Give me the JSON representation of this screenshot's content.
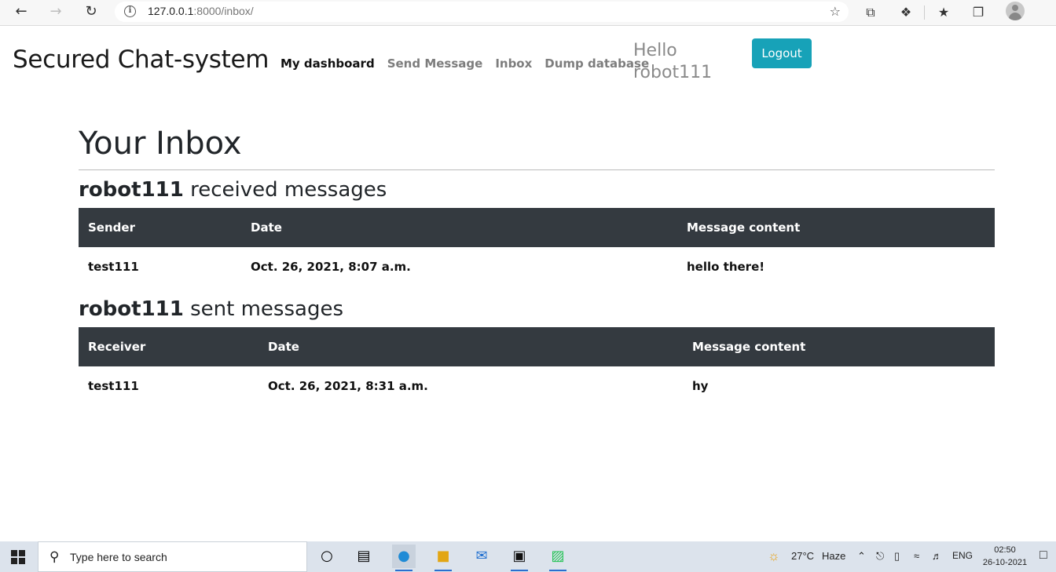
{
  "browser": {
    "url_host": "127.0.0.1",
    "url_rest": ":8000/inbox/"
  },
  "nav": {
    "brand": "Secured Chat-system",
    "links": [
      "My dashboard",
      "Send Message",
      "Inbox",
      "Dump database"
    ],
    "hello_line1": "Hello",
    "hello_line2": "robot111",
    "logout": "Logout"
  },
  "page": {
    "title": "Your Inbox",
    "received_user": "robot111",
    "received_suffix": " received messages",
    "sent_user": "robot111",
    "sent_suffix": " sent messages"
  },
  "received": {
    "headers": [
      "Sender",
      "Date",
      "Message content"
    ],
    "rows": [
      [
        "test111",
        "Oct. 26, 2021, 8:07 a.m.",
        "hello there!"
      ]
    ]
  },
  "sent": {
    "headers": [
      "Receiver",
      "Date",
      "Message content"
    ],
    "rows": [
      [
        "test111",
        "Oct. 26, 2021, 8:31 a.m.",
        "hy"
      ]
    ]
  },
  "taskbar": {
    "search_placeholder": "Type here to search",
    "weather_temp": "27°C",
    "weather_desc": "Haze",
    "lang": "ENG",
    "time": "02:50",
    "date": "26-10-2021"
  },
  "colors": {
    "logout_bg": "#17a2b8",
    "table_header_bg": "#343a40"
  }
}
